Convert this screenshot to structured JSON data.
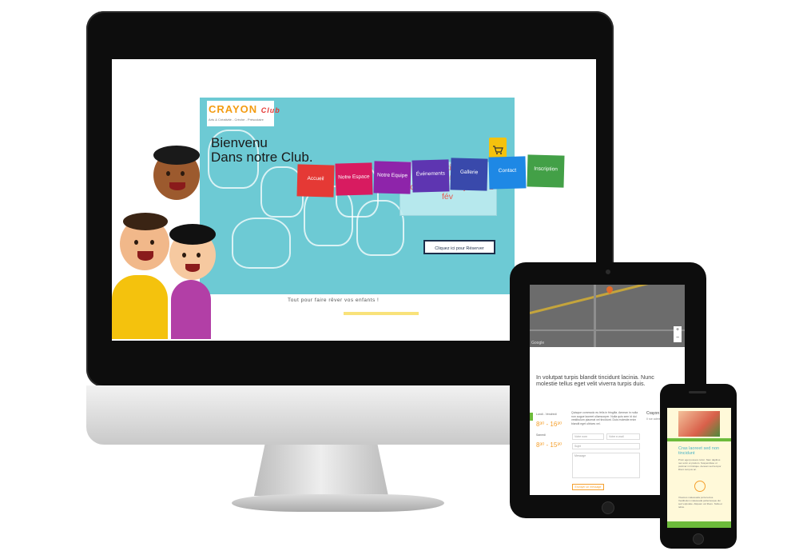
{
  "desktop": {
    "logo": "CRAYON",
    "logo_suffix": "Club",
    "logo_tagline": "Arts & Créativité - Crèche - Préscolaire",
    "nav": [
      {
        "label": "Accueil",
        "color": "#e53935"
      },
      {
        "label": "Notre Espace",
        "color": "#d81b60"
      },
      {
        "label": "Notre Equipe",
        "color": "#8e24aa"
      },
      {
        "label": "Événements",
        "color": "#5e35b1"
      },
      {
        "label": "Gallerie",
        "color": "#3949ab"
      },
      {
        "label": "Contact",
        "color": "#1e88e5"
      },
      {
        "label": "Inscription",
        "color": "#43a047"
      }
    ],
    "cart_icon": "cart-icon",
    "hero_title": "Bienvenu\nDans notre Club.",
    "promo": "Inscription au Programme des vacances Du 29 jan au 2 fév",
    "reserve_button": "Cliquez ici pour Réserver",
    "tagline": "Tout pour faire rêver vos enfants !",
    "hero_color": "#6dcad4"
  },
  "tablet": {
    "map_zoom_in": "+",
    "map_zoom_out": "−",
    "map_brand": "Google",
    "heading": "In volutpat turpis blandit tincidunt lacinia. Nunc molestie tellus eget velit viverra turpis duis.",
    "hours_label1": "Lundi - Vendredi",
    "hours_val1": "8³⁰ - 16³⁰",
    "hours_label2": "Samedi",
    "hours_val2": "8³⁰ - 15³⁰",
    "lorem": "Quisque commodo eu felis in fringilla. Aenean in nulla non augue laoreet ullamcorper. Nulla quis sem id dui vestibulum placerat vel tincidunt. Duis molestie enim blandit eget ultrices vel.",
    "placeholder_name": "Votre nom",
    "placeholder_email": "Votre e-mail",
    "placeholder_subject": "Sujet",
    "placeholder_message": "Message",
    "send_button": "Envoyer un message",
    "side_title": "Crayon",
    "side_text": "Il rue adresse ...",
    "accent": "#f5a02d"
  },
  "phone": {
    "title": "Cras laoreet sed non tincidunt",
    "text1": "Proin eget posuere tortor. Nam dapibus nec enim et pretium. Suspendisse ut pulvinar mi tristique. Aenean sed tempor libero tempus ac.",
    "text2": "Vivamus malesuada porta lectus. Vestibulum malesuada pellentesque dui sed vulputate. Aliquam vel libero. Nulla et tellus.",
    "clock_icon": "clock-icon",
    "bg": "#fff9d9"
  }
}
